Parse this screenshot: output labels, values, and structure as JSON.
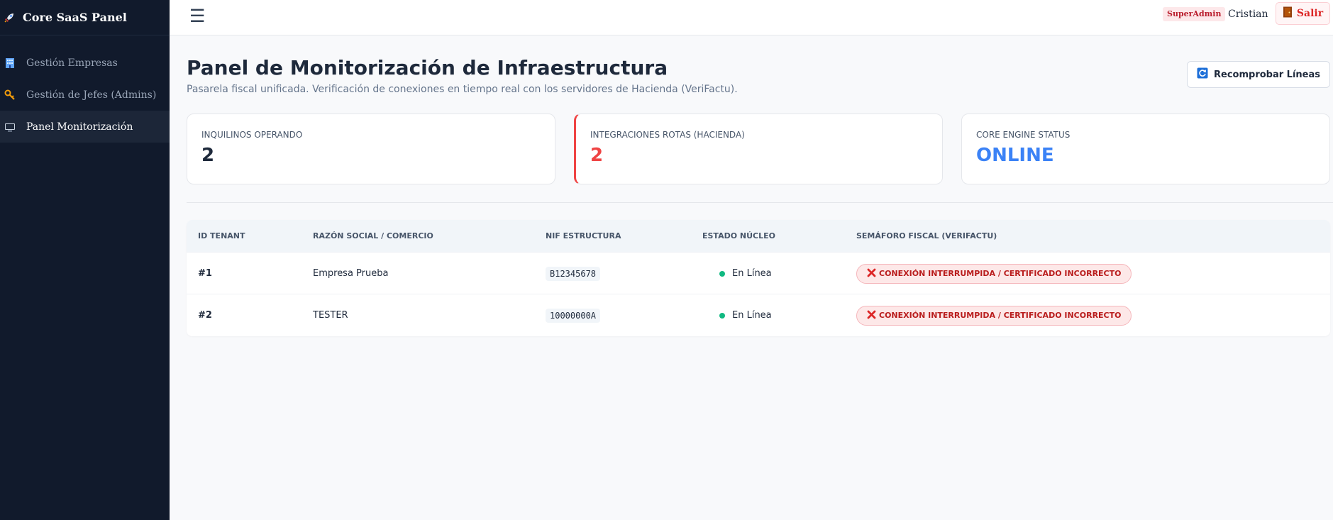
{
  "app": {
    "title": "Core SaaS Panel",
    "icon": "rocket-icon"
  },
  "sidebar": {
    "items": [
      {
        "label": "Gestión Empresas",
        "icon": "building-icon",
        "active": false
      },
      {
        "label": "Gestión de Jefes (Admins)",
        "icon": "key-icon",
        "active": false
      },
      {
        "label": "Panel Monitorización",
        "icon": "monitor-icon",
        "active": true
      }
    ]
  },
  "topbar": {
    "menu_icon": "hamburger-menu-icon",
    "role_badge": "SuperAdmin",
    "username": "Cristian",
    "logout_label": "Salir",
    "logout_icon": "door-icon"
  },
  "header": {
    "title": "Panel de Monitorización de Infraestructura",
    "subtitle": "Pasarela fiscal unificada. Verificación de conexiones en tiempo real con los servidores de Hacienda (VeriFactu).",
    "recheck_label": "Recomprobar Líneas",
    "recheck_icon": "refresh-icon"
  },
  "stats": [
    {
      "label": "INQUILINOS OPERANDO",
      "value": "2",
      "color": "#1e293b"
    },
    {
      "label": "INTEGRACIONES ROTAS (HACIENDA)",
      "value": "2",
      "color": "#ef4444"
    },
    {
      "label": "CORE ENGINE STATUS",
      "value": "ONLINE",
      "color": "#3b82f6"
    }
  ],
  "table": {
    "columns": [
      "ID TENANT",
      "RAZÓN SOCIAL / COMERCIO",
      "NIF ESTRUCTURA",
      "ESTADO NÚCLEO",
      "SEMÁFORO FISCAL (VERIFACTU)"
    ],
    "rows": [
      {
        "id": "#1",
        "name": "Empresa Prueba",
        "nif": "B12345678",
        "status": "En Línea",
        "fiscal": "CONEXIÓN INTERRUMPIDA / CERTIFICADO INCORRECTO"
      },
      {
        "id": "#2",
        "name": "TESTER",
        "nif": "10000000A",
        "status": "En Línea",
        "fiscal": "CONEXIÓN INTERRUMPIDA / CERTIFICADO INCORRECTO"
      }
    ]
  },
  "colors": {
    "sidebar_bg": "#111a2c",
    "danger": "#ef4444",
    "online": "#3b82f6",
    "status_ok": "#10b981"
  }
}
